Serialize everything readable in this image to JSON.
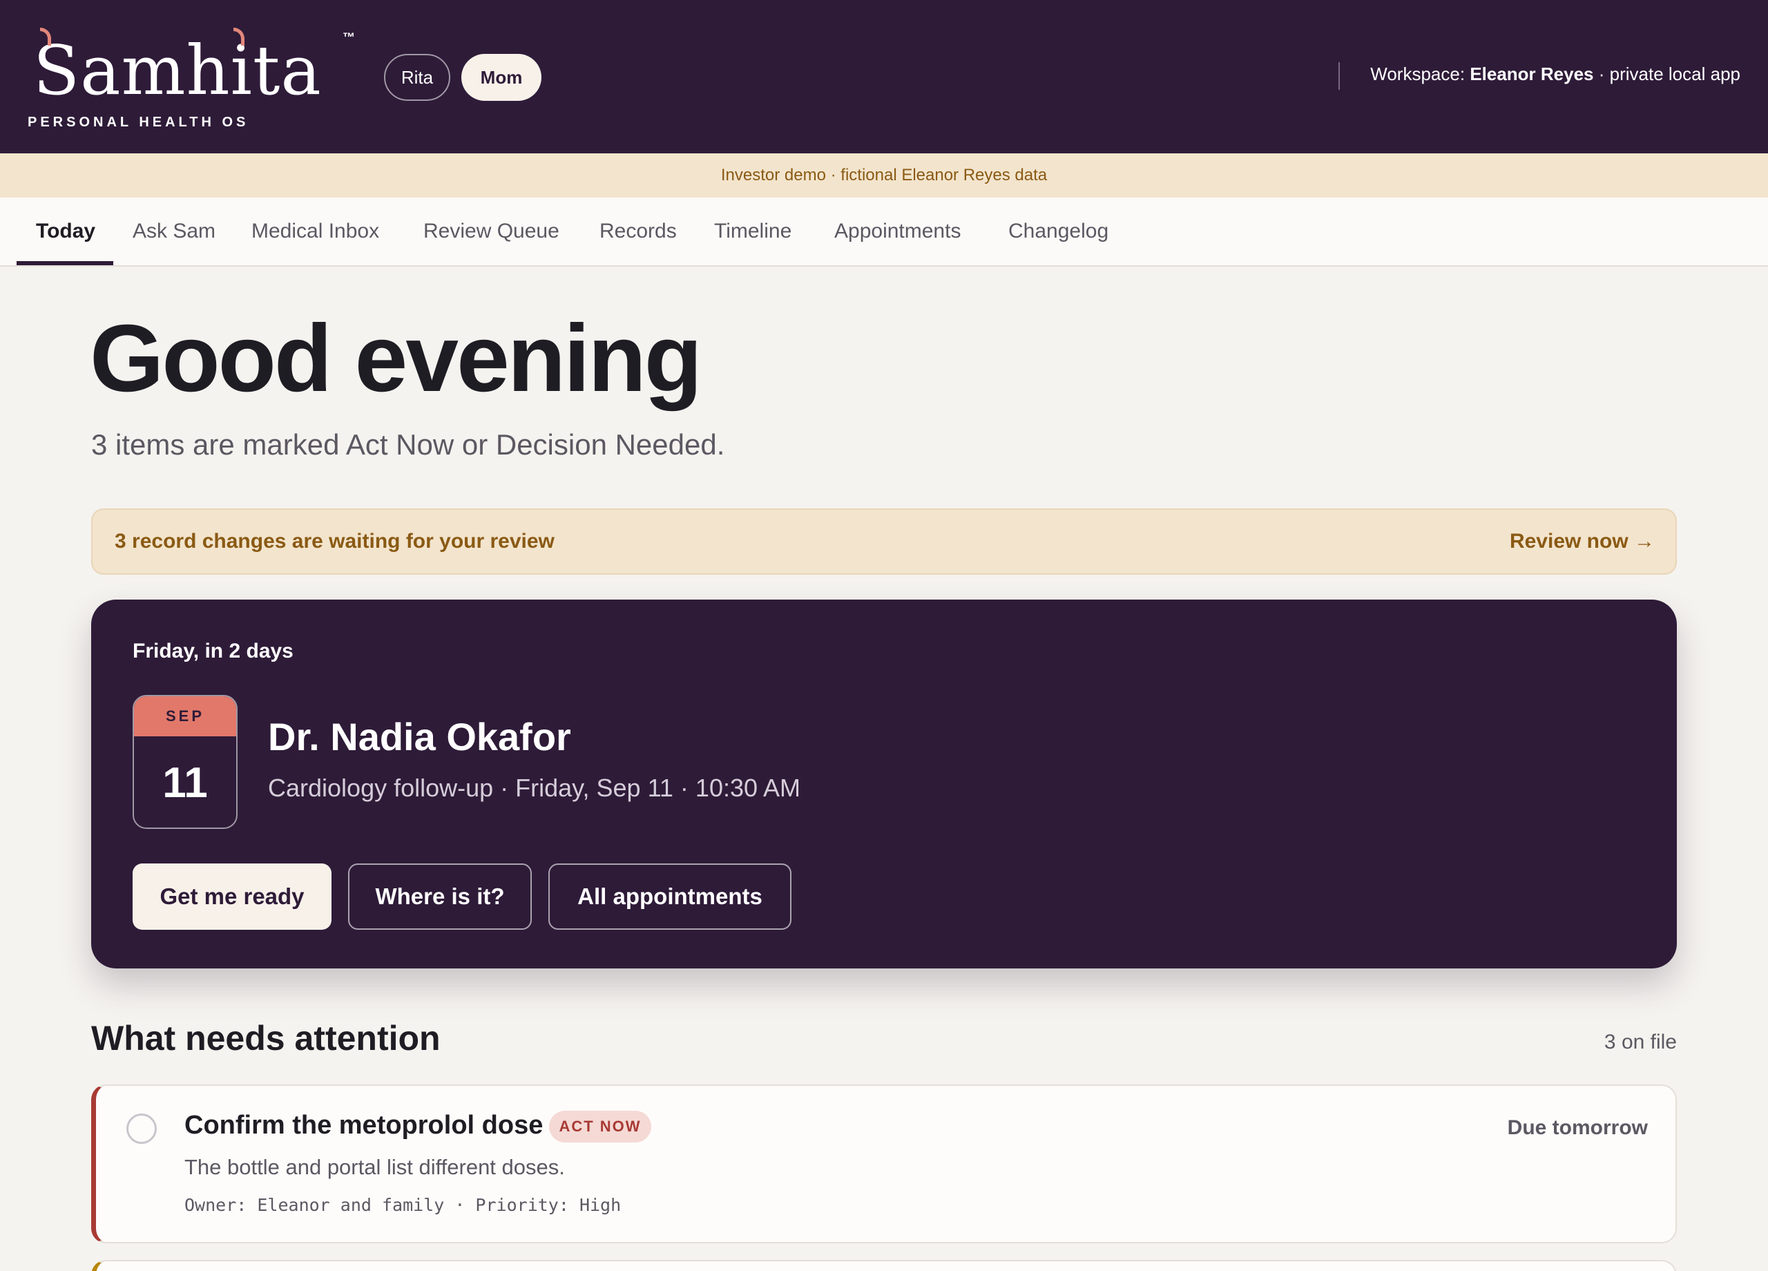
{
  "brand": {
    "name": "Samhita",
    "trademark": "™",
    "tagline": "PERSONAL HEALTH OS",
    "accent_color": "#e2877b"
  },
  "profiles": {
    "items": [
      {
        "label": "Rita",
        "selected": false
      },
      {
        "label": "Mom",
        "selected": true
      }
    ]
  },
  "workspace": {
    "prefix": "Workspace:",
    "name": "Eleanor Reyes",
    "suffix": "· private local app"
  },
  "banner": {
    "text": "Investor demo · fictional Eleanor Reyes data"
  },
  "nav": {
    "tabs": [
      {
        "label": "Today",
        "active": true
      },
      {
        "label": "Ask Sam",
        "active": false
      },
      {
        "label": "Medical Inbox",
        "active": false
      },
      {
        "label": "Review Queue",
        "active": false
      },
      {
        "label": "Records",
        "active": false
      },
      {
        "label": "Timeline",
        "active": false
      },
      {
        "label": "Appointments",
        "active": false
      },
      {
        "label": "Changelog",
        "active": false
      }
    ]
  },
  "today": {
    "greeting": "Good evening",
    "summary": "3 items are marked Act Now or Decision Needed."
  },
  "review_banner": {
    "text": "3 record changes are waiting for your review",
    "action": "Review now →"
  },
  "appointment": {
    "when": "Friday, in 2 days",
    "month": "SEP",
    "day": "11",
    "doctor": "Dr. Nadia Okafor",
    "detail": "Cardiology follow-up · Friday, Sep 11 · 10:30 AM",
    "buttons": {
      "primary": "Get me ready",
      "where": "Where is it?",
      "all": "All appointments"
    }
  },
  "attention": {
    "title": "What needs attention",
    "count": "3 on file",
    "items": [
      {
        "title": "Confirm the metoprolol dose",
        "badge": "ACT NOW",
        "due": "Due tomorrow",
        "description": "The bottle and portal list different doses.",
        "meta": "Owner: Eleanor and family · Priority: High"
      }
    ]
  },
  "colors": {
    "header_bg": "#2e1b38",
    "banner_bg": "#f3e4cd",
    "banner_text": "#8a5a14",
    "badge_act_now": "#a83a34",
    "calendar_month": "#e2786a"
  }
}
